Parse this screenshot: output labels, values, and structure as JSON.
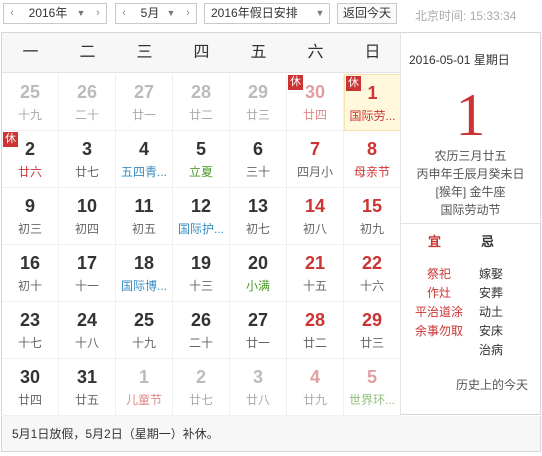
{
  "toolbar": {
    "year_value": "2016年",
    "month_value": "5月",
    "holiday_value": "2016年假日安排",
    "today_label": "返回今天",
    "clock_label": "北京时间:",
    "clock_time": "15:33:34",
    "prev_arrow": "‹",
    "next_arrow": "›",
    "dropdown_arrow": "▼"
  },
  "weekdays": [
    "一",
    "二",
    "三",
    "四",
    "五",
    "六",
    "日"
  ],
  "days": [
    {
      "n": "25",
      "s": "十九",
      "other": true
    },
    {
      "n": "26",
      "s": "二十",
      "other": true
    },
    {
      "n": "27",
      "s": "廿一",
      "other": true
    },
    {
      "n": "28",
      "s": "廿二",
      "other": true
    },
    {
      "n": "29",
      "s": "廿三",
      "other": true
    },
    {
      "n": "30",
      "s": "廿四",
      "other": true,
      "weekend": true,
      "badge": "休",
      "sred": true
    },
    {
      "n": "1",
      "s": "国际劳...",
      "weekend": true,
      "badge": "休",
      "selected": true,
      "sred": true
    },
    {
      "n": "2",
      "s": "廿六",
      "badge": "休",
      "sred": true
    },
    {
      "n": "3",
      "s": "廿七"
    },
    {
      "n": "4",
      "s": "五四青...",
      "festival": true
    },
    {
      "n": "5",
      "s": "立夏",
      "green": true
    },
    {
      "n": "6",
      "s": "三十"
    },
    {
      "n": "7",
      "s": "四月小",
      "weekend": true
    },
    {
      "n": "8",
      "s": "母亲节",
      "weekend": true,
      "sred": true
    },
    {
      "n": "9",
      "s": "初三"
    },
    {
      "n": "10",
      "s": "初四"
    },
    {
      "n": "11",
      "s": "初五"
    },
    {
      "n": "12",
      "s": "国际护...",
      "festival": true
    },
    {
      "n": "13",
      "s": "初七"
    },
    {
      "n": "14",
      "s": "初八",
      "weekend": true
    },
    {
      "n": "15",
      "s": "初九",
      "weekend": true
    },
    {
      "n": "16",
      "s": "初十"
    },
    {
      "n": "17",
      "s": "十一"
    },
    {
      "n": "18",
      "s": "国际博...",
      "festival": true
    },
    {
      "n": "19",
      "s": "十三"
    },
    {
      "n": "20",
      "s": "小满",
      "green": true
    },
    {
      "n": "21",
      "s": "十五",
      "weekend": true
    },
    {
      "n": "22",
      "s": "十六",
      "weekend": true
    },
    {
      "n": "23",
      "s": "十七"
    },
    {
      "n": "24",
      "s": "十八"
    },
    {
      "n": "25",
      "s": "十九"
    },
    {
      "n": "26",
      "s": "二十"
    },
    {
      "n": "27",
      "s": "廿一"
    },
    {
      "n": "28",
      "s": "廿二",
      "weekend": true
    },
    {
      "n": "29",
      "s": "廿三",
      "weekend": true
    },
    {
      "n": "30",
      "s": "廿四"
    },
    {
      "n": "31",
      "s": "廿五"
    },
    {
      "n": "1",
      "s": "儿童节",
      "other": true,
      "sred": true
    },
    {
      "n": "2",
      "s": "廿七",
      "other": true
    },
    {
      "n": "3",
      "s": "廿八",
      "other": true
    },
    {
      "n": "4",
      "s": "廿九",
      "other": true,
      "weekend": true
    },
    {
      "n": "5",
      "s": "世界环...",
      "other": true,
      "weekend": true,
      "green": true
    }
  ],
  "detail": {
    "date_line": "2016-05-01  星期日",
    "big_day": "1",
    "lunar": "农历三月廿五",
    "ganzhi": "丙申年壬辰月癸未日",
    "zodiac": "[猴年] 金牛座",
    "festival": "国际劳动节",
    "yi_label": "宜",
    "ji_label": "忌",
    "yi_items": [
      "祭祀",
      "作灶",
      "平治道涂",
      "余事勿取"
    ],
    "ji_items": [
      "嫁娶",
      "安葬",
      "动土",
      "安床",
      "治病"
    ],
    "history": "历史上的今天"
  },
  "footer": {
    "note": "5月1日放假，5月2日（星期一）补休。"
  },
  "colors": {
    "accent_red": "#cc3333",
    "festival_blue": "#3a8dc1",
    "solar_term_green": "#4d9a2a",
    "selected_bg": "#fff8dc"
  }
}
